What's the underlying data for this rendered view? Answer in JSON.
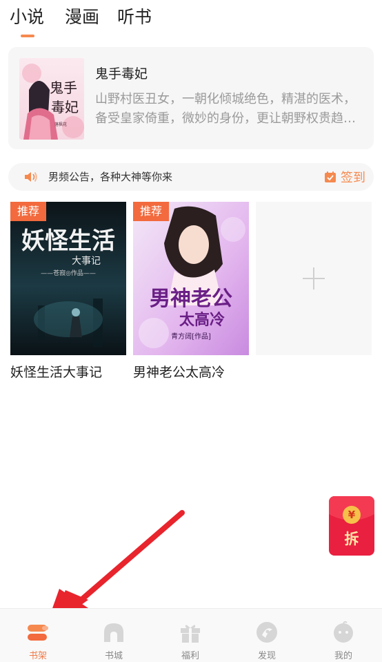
{
  "colors": {
    "accent": "#f5894e",
    "badge": "#f26a3d",
    "redpacket": "#e9203f",
    "arrow": "#e8242d",
    "nav_inactive": "#d6d6d6"
  },
  "tabs": [
    {
      "label": "小说",
      "active": true
    },
    {
      "label": "漫画",
      "active": false
    },
    {
      "label": "听书",
      "active": false
    }
  ],
  "featured": {
    "title": "鬼手毒妃",
    "description": "山野村医丑女，一朝化倾城绝色，精湛的医术，备受皇家倚重，微妙的身份，更让朝野权贵趋…",
    "cover_text": "鬼手毒妃",
    "cover_author": "落枫花"
  },
  "notice": {
    "icon": "speaker-icon",
    "text": "男频公告，各种大神等你来",
    "checkin_label": "签到",
    "checkin_icon": "calendar-check-icon"
  },
  "books": [
    {
      "badge": "推荐",
      "title": "妖怪生活大事记",
      "cover_title": "妖怪生活",
      "cover_subtitle": "大事记",
      "cover_author": "——苍寂◎作品——"
    },
    {
      "badge": "推荐",
      "title": "男神老公太高冷",
      "cover_title": "男神老公",
      "cover_subtitle": "太高冷",
      "cover_author": "青方阔[作品]"
    }
  ],
  "add_slot": {
    "icon": "plus-icon"
  },
  "redpacket": {
    "coin": "¥",
    "label": "拆"
  },
  "bottom_nav": [
    {
      "label": "书架",
      "icon": "bookshelf-icon",
      "active": true
    },
    {
      "label": "书城",
      "icon": "bookstore-icon",
      "active": false
    },
    {
      "label": "福利",
      "icon": "gift-icon",
      "active": false
    },
    {
      "label": "发现",
      "icon": "discover-icon",
      "active": false
    },
    {
      "label": "我的",
      "icon": "profile-icon",
      "active": false
    }
  ]
}
